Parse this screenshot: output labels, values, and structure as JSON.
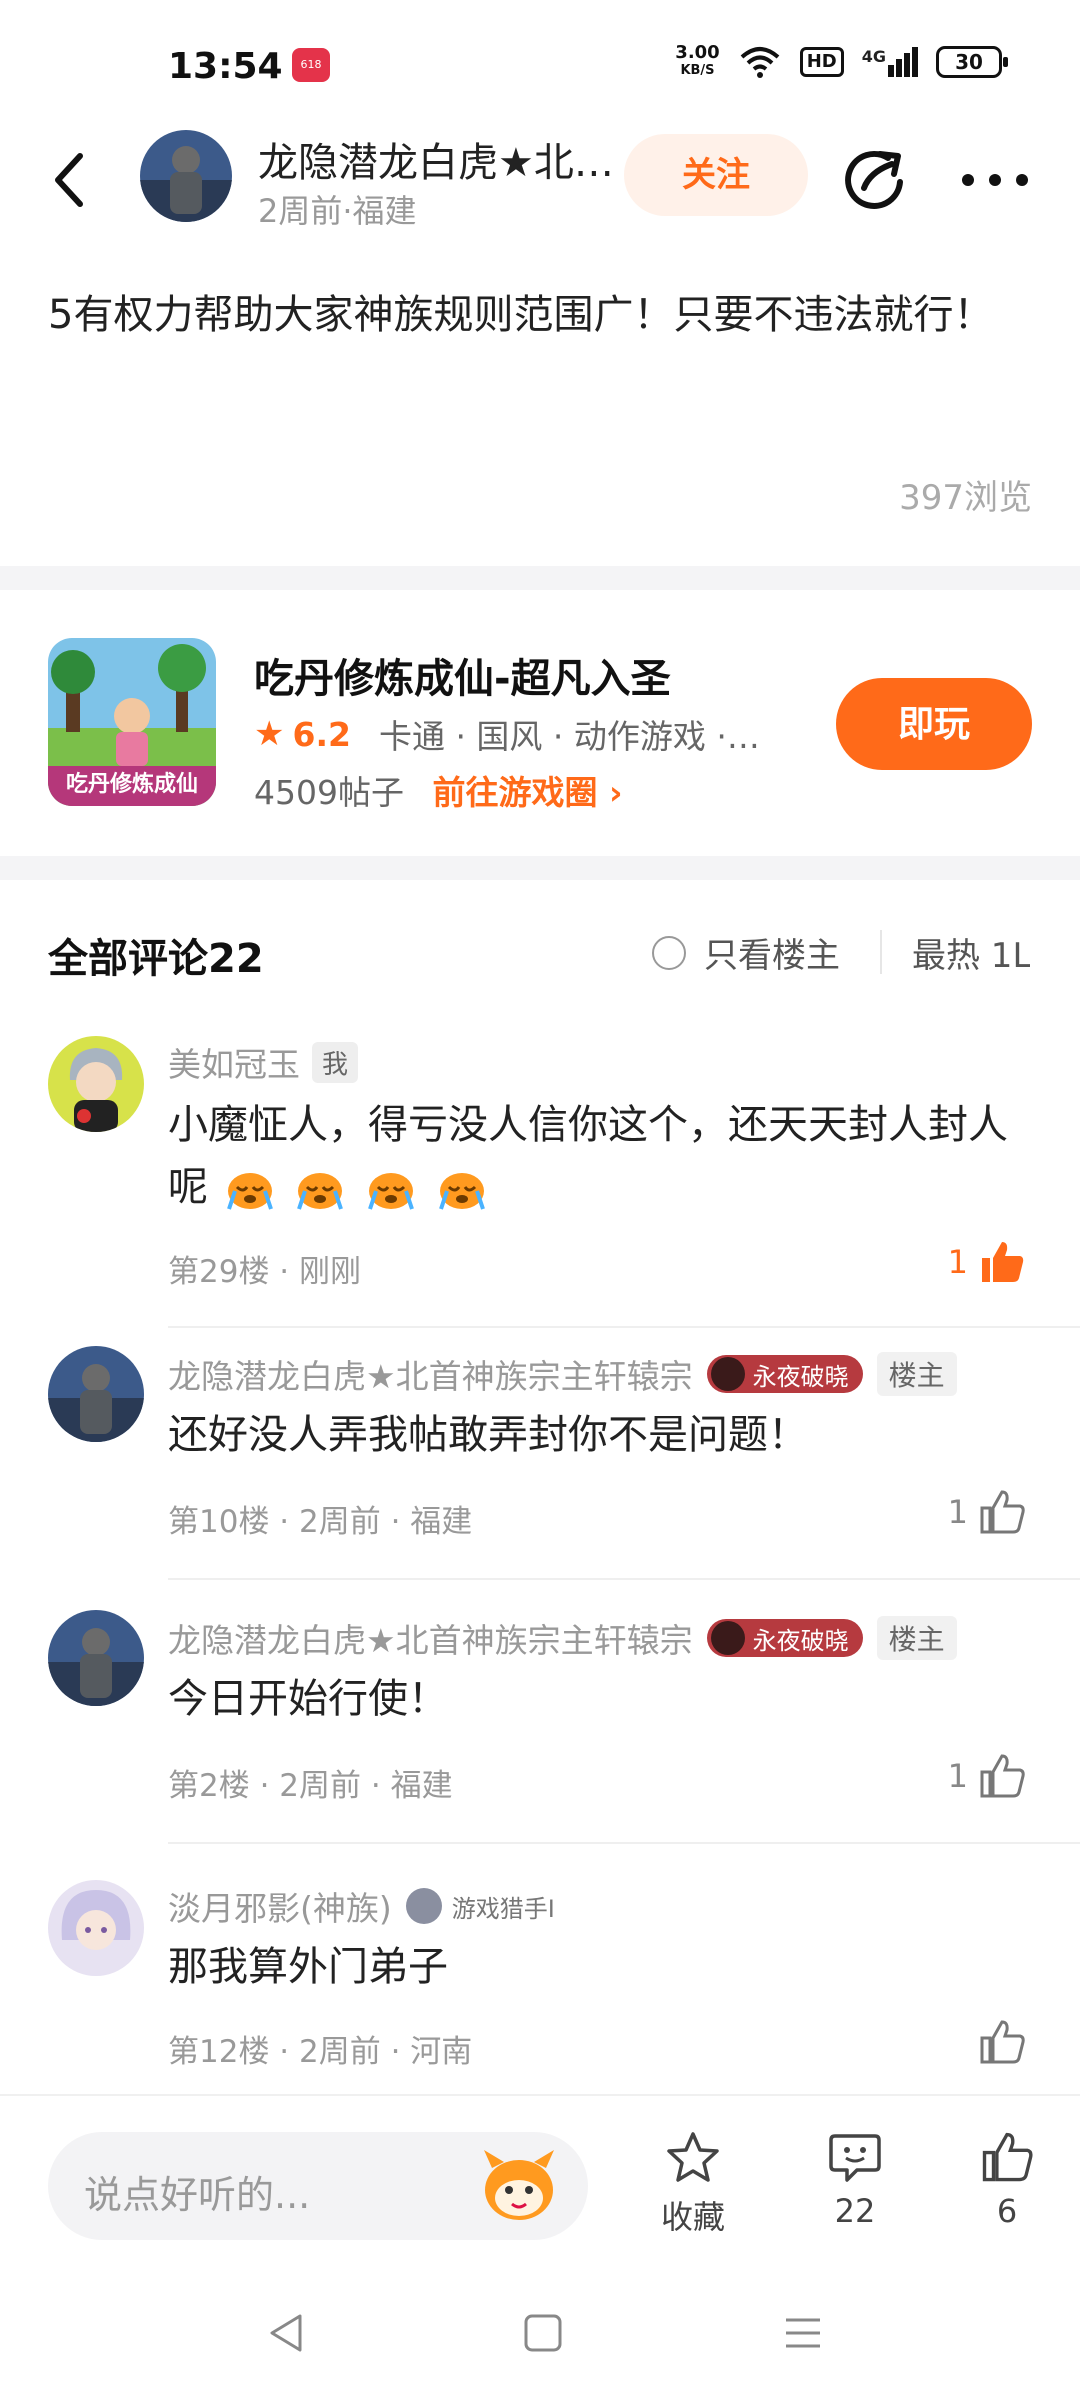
{
  "status": {
    "time": "13:54",
    "app_badge": "618",
    "speed_top": "3.00",
    "speed_bottom": "KB/S",
    "hd": "HD",
    "network": "4G",
    "battery": "30"
  },
  "header": {
    "author_name": "龙隐潜龙白虎★北…",
    "author_meta": "2周前·福建",
    "follow_label": "关注"
  },
  "post": {
    "body": "5有权力帮助大家神族规则范围广！只要不违法就行！",
    "views": "397浏览"
  },
  "game": {
    "title": "吃丹修炼成仙-超凡入圣",
    "icon_text": "吃丹修炼成仙",
    "score": "6.2",
    "tags": "卡通 · 国风 · 动作游戏 · …",
    "posts": "4509帖子",
    "circle_link": "前往游戏圈",
    "play_label": "即玩",
    "accent": "#ff6a19"
  },
  "comments_header": {
    "title": "全部评论22",
    "only_op": "只看楼主",
    "sort": "最热 1L"
  },
  "comments": [
    {
      "name": "美如冠玉",
      "badge": "我",
      "text": "小魔怔人，得亏没人信你这个，还天天封人封人呢",
      "meta": "第29楼 · 刚刚",
      "likes": "1",
      "liked": true
    },
    {
      "name": "龙隐潜龙白虎★北首神族宗主轩辕宗",
      "title_badge": "永夜破晓",
      "op_badge": "楼主",
      "text": "还好没人弄我帖敢弄封你不是问题！",
      "meta": "第10楼 · 2周前 · 福建",
      "likes": "1"
    },
    {
      "name": "龙隐潜龙白虎★北首神族宗主轩辕宗",
      "title_badge": "永夜破晓",
      "op_badge": "楼主",
      "text": "今日开始行使！",
      "meta": "第2楼 · 2周前 · 福建",
      "likes": "1"
    },
    {
      "name": "淡月邪影(神族)",
      "rank_badge": "游戏猎手I",
      "text": "那我算外门弟子",
      "meta": "第12楼 · 2周前 · 河南",
      "likes": ""
    }
  ],
  "bottom_bar": {
    "placeholder": "说点好听的...",
    "collect_label": "收藏",
    "comment_count": "22",
    "like_count": "6"
  }
}
